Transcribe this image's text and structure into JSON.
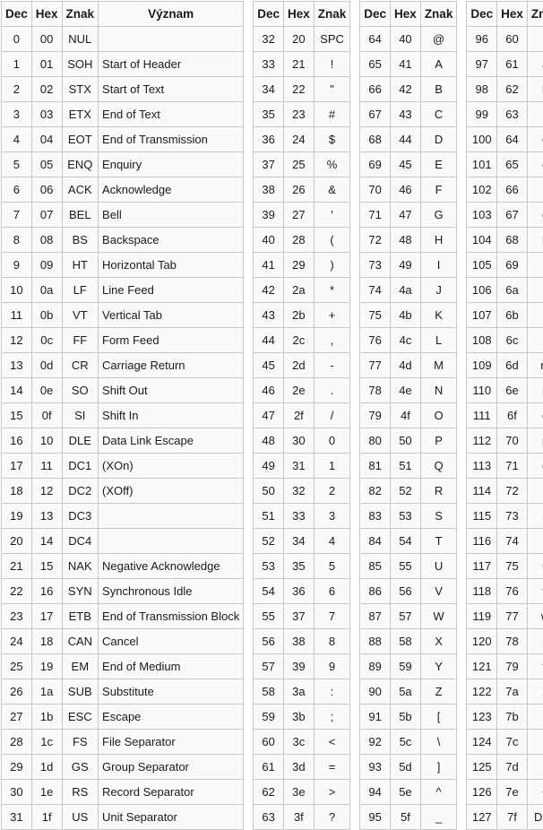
{
  "headers": {
    "dec": "Dec",
    "hex": "Hex",
    "znak": "Znak",
    "vyznam": "Význam"
  },
  "tables": [
    {
      "has_meaning": true,
      "rows": [
        {
          "dec": "0",
          "hex": "00",
          "znak": "NUL",
          "vyznam": ""
        },
        {
          "dec": "1",
          "hex": "01",
          "znak": "SOH",
          "vyznam": "Start of Header"
        },
        {
          "dec": "2",
          "hex": "02",
          "znak": "STX",
          "vyznam": "Start of Text"
        },
        {
          "dec": "3",
          "hex": "03",
          "znak": "ETX",
          "vyznam": "End of Text"
        },
        {
          "dec": "4",
          "hex": "04",
          "znak": "EOT",
          "vyznam": "End of Transmission"
        },
        {
          "dec": "5",
          "hex": "05",
          "znak": "ENQ",
          "vyznam": "Enquiry"
        },
        {
          "dec": "6",
          "hex": "06",
          "znak": "ACK",
          "vyznam": "Acknowledge"
        },
        {
          "dec": "7",
          "hex": "07",
          "znak": "BEL",
          "vyznam": "Bell"
        },
        {
          "dec": "8",
          "hex": "08",
          "znak": "BS",
          "vyznam": "Backspace"
        },
        {
          "dec": "9",
          "hex": "09",
          "znak": "HT",
          "vyznam": "Horizontal Tab"
        },
        {
          "dec": "10",
          "hex": "0a",
          "znak": "LF",
          "vyznam": "Line Feed"
        },
        {
          "dec": "11",
          "hex": "0b",
          "znak": "VT",
          "vyznam": "Vertical Tab"
        },
        {
          "dec": "12",
          "hex": "0c",
          "znak": "FF",
          "vyznam": "Form Feed"
        },
        {
          "dec": "13",
          "hex": "0d",
          "znak": "CR",
          "vyznam": "Carriage Return"
        },
        {
          "dec": "14",
          "hex": "0e",
          "znak": "SO",
          "vyznam": "Shift Out"
        },
        {
          "dec": "15",
          "hex": "0f",
          "znak": "SI",
          "vyznam": "Shift In"
        },
        {
          "dec": "16",
          "hex": "10",
          "znak": "DLE",
          "vyznam": "Data Link Escape"
        },
        {
          "dec": "17",
          "hex": "11",
          "znak": "DC1",
          "vyznam": "(XOn)"
        },
        {
          "dec": "18",
          "hex": "12",
          "znak": "DC2",
          "vyznam": "(XOff)"
        },
        {
          "dec": "19",
          "hex": "13",
          "znak": "DC3",
          "vyznam": ""
        },
        {
          "dec": "20",
          "hex": "14",
          "znak": "DC4",
          "vyznam": ""
        },
        {
          "dec": "21",
          "hex": "15",
          "znak": "NAK",
          "vyznam": "Negative Acknowledge"
        },
        {
          "dec": "22",
          "hex": "16",
          "znak": "SYN",
          "vyznam": "Synchronous Idle"
        },
        {
          "dec": "23",
          "hex": "17",
          "znak": "ETB",
          "vyznam": "End of Transmission Block"
        },
        {
          "dec": "24",
          "hex": "18",
          "znak": "CAN",
          "vyznam": "Cancel"
        },
        {
          "dec": "25",
          "hex": "19",
          "znak": "EM",
          "vyznam": "End of Medium"
        },
        {
          "dec": "26",
          "hex": "1a",
          "znak": "SUB",
          "vyznam": "Substitute"
        },
        {
          "dec": "27",
          "hex": "1b",
          "znak": "ESC",
          "vyznam": "Escape"
        },
        {
          "dec": "28",
          "hex": "1c",
          "znak": "FS",
          "vyznam": "File Separator"
        },
        {
          "dec": "29",
          "hex": "1d",
          "znak": "GS",
          "vyznam": "Group Separator"
        },
        {
          "dec": "30",
          "hex": "1e",
          "znak": "RS",
          "vyznam": "Record Separator"
        },
        {
          "dec": "31",
          "hex": "1f",
          "znak": "US",
          "vyznam": "Unit Separator"
        }
      ]
    },
    {
      "has_meaning": false,
      "rows": [
        {
          "dec": "32",
          "hex": "20",
          "znak": "SPC"
        },
        {
          "dec": "33",
          "hex": "21",
          "znak": "!"
        },
        {
          "dec": "34",
          "hex": "22",
          "znak": "\""
        },
        {
          "dec": "35",
          "hex": "23",
          "znak": "#"
        },
        {
          "dec": "36",
          "hex": "24",
          "znak": "$"
        },
        {
          "dec": "37",
          "hex": "25",
          "znak": "%"
        },
        {
          "dec": "38",
          "hex": "26",
          "znak": "&"
        },
        {
          "dec": "39",
          "hex": "27",
          "znak": "'"
        },
        {
          "dec": "40",
          "hex": "28",
          "znak": "("
        },
        {
          "dec": "41",
          "hex": "29",
          "znak": ")"
        },
        {
          "dec": "42",
          "hex": "2a",
          "znak": "*"
        },
        {
          "dec": "43",
          "hex": "2b",
          "znak": "+"
        },
        {
          "dec": "44",
          "hex": "2c",
          "znak": ","
        },
        {
          "dec": "45",
          "hex": "2d",
          "znak": "-"
        },
        {
          "dec": "46",
          "hex": "2e",
          "znak": "."
        },
        {
          "dec": "47",
          "hex": "2f",
          "znak": "/"
        },
        {
          "dec": "48",
          "hex": "30",
          "znak": "0"
        },
        {
          "dec": "49",
          "hex": "31",
          "znak": "1"
        },
        {
          "dec": "50",
          "hex": "32",
          "znak": "2"
        },
        {
          "dec": "51",
          "hex": "33",
          "znak": "3"
        },
        {
          "dec": "52",
          "hex": "34",
          "znak": "4"
        },
        {
          "dec": "53",
          "hex": "35",
          "znak": "5"
        },
        {
          "dec": "54",
          "hex": "36",
          "znak": "6"
        },
        {
          "dec": "55",
          "hex": "37",
          "znak": "7"
        },
        {
          "dec": "56",
          "hex": "38",
          "znak": "8"
        },
        {
          "dec": "57",
          "hex": "39",
          "znak": "9"
        },
        {
          "dec": "58",
          "hex": "3a",
          "znak": ":"
        },
        {
          "dec": "59",
          "hex": "3b",
          "znak": ";"
        },
        {
          "dec": "60",
          "hex": "3c",
          "znak": "<"
        },
        {
          "dec": "61",
          "hex": "3d",
          "znak": "="
        },
        {
          "dec": "62",
          "hex": "3e",
          "znak": ">"
        },
        {
          "dec": "63",
          "hex": "3f",
          "znak": "?"
        }
      ]
    },
    {
      "has_meaning": false,
      "rows": [
        {
          "dec": "64",
          "hex": "40",
          "znak": "@"
        },
        {
          "dec": "65",
          "hex": "41",
          "znak": "A"
        },
        {
          "dec": "66",
          "hex": "42",
          "znak": "B"
        },
        {
          "dec": "67",
          "hex": "43",
          "znak": "C"
        },
        {
          "dec": "68",
          "hex": "44",
          "znak": "D"
        },
        {
          "dec": "69",
          "hex": "45",
          "znak": "E"
        },
        {
          "dec": "70",
          "hex": "46",
          "znak": "F"
        },
        {
          "dec": "71",
          "hex": "47",
          "znak": "G"
        },
        {
          "dec": "72",
          "hex": "48",
          "znak": "H"
        },
        {
          "dec": "73",
          "hex": "49",
          "znak": "I"
        },
        {
          "dec": "74",
          "hex": "4a",
          "znak": "J"
        },
        {
          "dec": "75",
          "hex": "4b",
          "znak": "K"
        },
        {
          "dec": "76",
          "hex": "4c",
          "znak": "L"
        },
        {
          "dec": "77",
          "hex": "4d",
          "znak": "M"
        },
        {
          "dec": "78",
          "hex": "4e",
          "znak": "N"
        },
        {
          "dec": "79",
          "hex": "4f",
          "znak": "O"
        },
        {
          "dec": "80",
          "hex": "50",
          "znak": "P"
        },
        {
          "dec": "81",
          "hex": "51",
          "znak": "Q"
        },
        {
          "dec": "82",
          "hex": "52",
          "znak": "R"
        },
        {
          "dec": "83",
          "hex": "53",
          "znak": "S"
        },
        {
          "dec": "84",
          "hex": "54",
          "znak": "T"
        },
        {
          "dec": "85",
          "hex": "55",
          "znak": "U"
        },
        {
          "dec": "86",
          "hex": "56",
          "znak": "V"
        },
        {
          "dec": "87",
          "hex": "57",
          "znak": "W"
        },
        {
          "dec": "88",
          "hex": "58",
          "znak": "X"
        },
        {
          "dec": "89",
          "hex": "59",
          "znak": "Y"
        },
        {
          "dec": "90",
          "hex": "5a",
          "znak": "Z"
        },
        {
          "dec": "91",
          "hex": "5b",
          "znak": "["
        },
        {
          "dec": "92",
          "hex": "5c",
          "znak": "\\"
        },
        {
          "dec": "93",
          "hex": "5d",
          "znak": "]"
        },
        {
          "dec": "94",
          "hex": "5e",
          "znak": "^"
        },
        {
          "dec": "95",
          "hex": "5f",
          "znak": "_"
        }
      ]
    },
    {
      "has_meaning": false,
      "rows": [
        {
          "dec": "96",
          "hex": "60",
          "znak": "`"
        },
        {
          "dec": "97",
          "hex": "61",
          "znak": "a"
        },
        {
          "dec": "98",
          "hex": "62",
          "znak": "b"
        },
        {
          "dec": "99",
          "hex": "63",
          "znak": "c"
        },
        {
          "dec": "100",
          "hex": "64",
          "znak": "d"
        },
        {
          "dec": "101",
          "hex": "65",
          "znak": "e"
        },
        {
          "dec": "102",
          "hex": "66",
          "znak": "f"
        },
        {
          "dec": "103",
          "hex": "67",
          "znak": "g"
        },
        {
          "dec": "104",
          "hex": "68",
          "znak": "h"
        },
        {
          "dec": "105",
          "hex": "69",
          "znak": "i"
        },
        {
          "dec": "106",
          "hex": "6a",
          "znak": "j"
        },
        {
          "dec": "107",
          "hex": "6b",
          "znak": "k"
        },
        {
          "dec": "108",
          "hex": "6c",
          "znak": "l"
        },
        {
          "dec": "109",
          "hex": "6d",
          "znak": "m"
        },
        {
          "dec": "110",
          "hex": "6e",
          "znak": "n"
        },
        {
          "dec": "111",
          "hex": "6f",
          "znak": "o"
        },
        {
          "dec": "112",
          "hex": "70",
          "znak": "p"
        },
        {
          "dec": "113",
          "hex": "71",
          "znak": "q"
        },
        {
          "dec": "114",
          "hex": "72",
          "znak": "r"
        },
        {
          "dec": "115",
          "hex": "73",
          "znak": "s"
        },
        {
          "dec": "116",
          "hex": "74",
          "znak": "t"
        },
        {
          "dec": "117",
          "hex": "75",
          "znak": "u"
        },
        {
          "dec": "118",
          "hex": "76",
          "znak": "v"
        },
        {
          "dec": "119",
          "hex": "77",
          "znak": "w"
        },
        {
          "dec": "120",
          "hex": "78",
          "znak": "x"
        },
        {
          "dec": "121",
          "hex": "79",
          "znak": "y"
        },
        {
          "dec": "122",
          "hex": "7a",
          "znak": "z"
        },
        {
          "dec": "123",
          "hex": "7b",
          "znak": "{"
        },
        {
          "dec": "124",
          "hex": "7c",
          "znak": "|"
        },
        {
          "dec": "125",
          "hex": "7d",
          "znak": "}"
        },
        {
          "dec": "126",
          "hex": "7e",
          "znak": "~"
        },
        {
          "dec": "127",
          "hex": "7f",
          "znak": "DEL"
        }
      ]
    }
  ],
  "colors": {
    "border": "#c8c8c8",
    "cell_background": "#fafafa",
    "text": "#1a1a1a",
    "page_background": "#ffffff"
  }
}
